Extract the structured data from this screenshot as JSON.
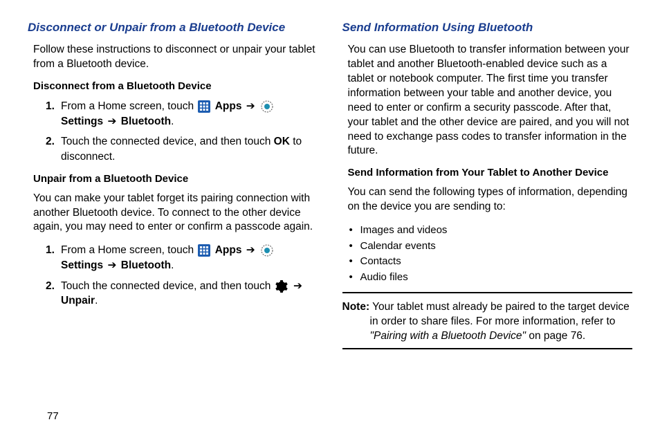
{
  "left": {
    "heading": "Disconnect or Unpair from a Bluetooth Device",
    "intro": "Follow these instructions to disconnect or unpair your tablet from a Bluetooth device.",
    "disconnect": {
      "title": "Disconnect from a Bluetooth Device",
      "step1_a": "From a Home screen, touch ",
      "step1_apps": " Apps ",
      "step1_settings": " Settings ",
      "step1_bt": " Bluetooth",
      "step2_a": "Touch the connected device, and then touch ",
      "step2_ok": "OK",
      "step2_b": " to disconnect."
    },
    "unpair": {
      "title": "Unpair from a Bluetooth Device",
      "intro": "You can make your tablet forget its pairing connection with another Bluetooth device. To connect to the other device again, you may need to enter or confirm a passcode again.",
      "step1_a": "From a Home screen, touch ",
      "step1_apps": " Apps ",
      "step1_settings": " Settings ",
      "step1_bt": " Bluetooth",
      "step2_a": "Touch the connected device, and then touch ",
      "step2_unpair": "Unpair"
    }
  },
  "right": {
    "heading": "Send Information Using Bluetooth",
    "intro": "You can use Bluetooth to transfer information between your tablet and another Bluetooth-enabled device such as a tablet or notebook computer. The first time you transfer information between your table and another device, you need to enter or confirm a security passcode. After that, your tablet and the other device are paired, and you will not need to exchange pass codes to transfer information in the future.",
    "send": {
      "title": "Send Information from Your Tablet to Another Device",
      "intro": "You can send the following types of information, depending on the device you are sending to:",
      "bullets": [
        "Images and videos",
        "Calendar events",
        "Contacts",
        "Audio files"
      ]
    },
    "note_label": "Note:",
    "note_a": " Your tablet must already be paired to the target device in order to share files. For more information, refer to ",
    "note_ref": "\"Pairing with a Bluetooth Device\"",
    "note_b": " on page 76."
  },
  "arrow": "➔",
  "page": "77"
}
